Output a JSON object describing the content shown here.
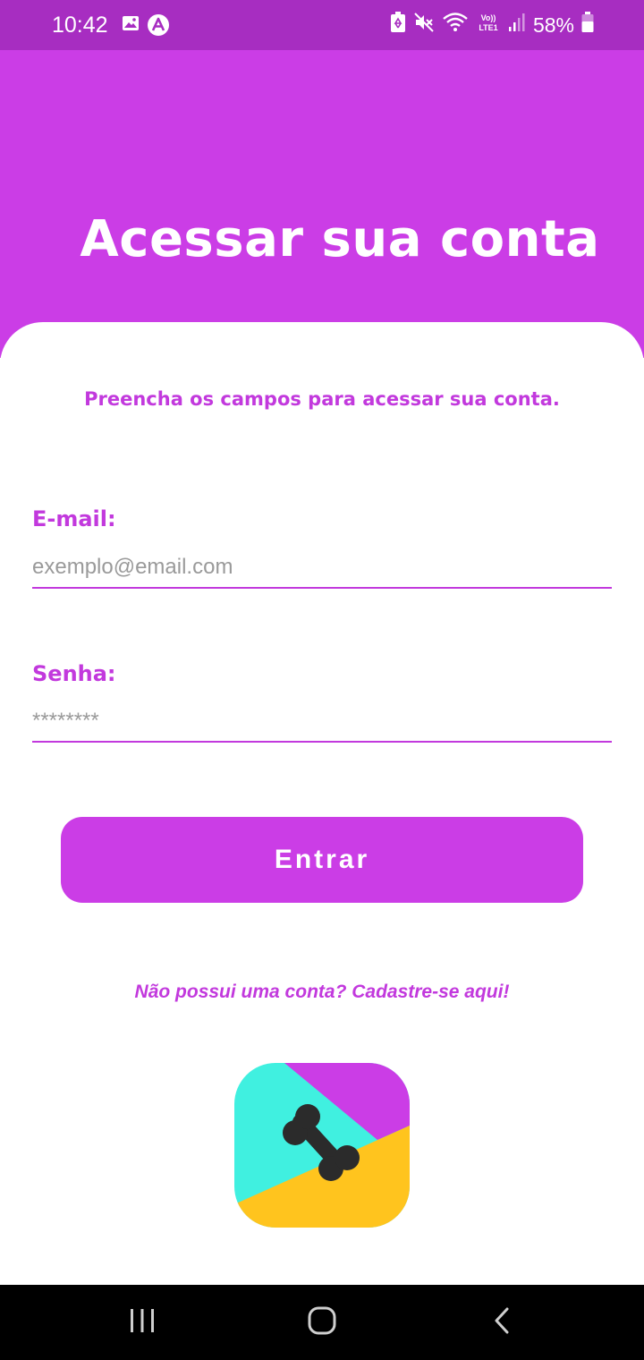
{
  "status_bar": {
    "time": "10:42",
    "battery_percent": "58%",
    "icons": [
      "image-icon",
      "notification-app-icon",
      "battery-saver-icon",
      "mute-icon",
      "wifi-icon",
      "volte-icon",
      "signal-icon",
      "battery-icon"
    ]
  },
  "header": {
    "title": "Acessar sua conta"
  },
  "form": {
    "subtitle": "Preencha os campos para acessar sua conta.",
    "email": {
      "label": "E-mail:",
      "placeholder": "exemplo@email.com",
      "value": ""
    },
    "password": {
      "label": "Senha:",
      "placeholder": "********",
      "value": ""
    },
    "submit_label": "Entrar",
    "signup_link": "Não possui uma conta? Cadastre-se aqui!"
  },
  "logo": {
    "icon": "bone-icon",
    "colors": {
      "cyan": "#40f0e0",
      "purple": "#cb3de6",
      "yellow": "#ffc41e",
      "bone": "#2b2b2b"
    }
  },
  "nav_bar": {
    "buttons": [
      "recent-apps-icon",
      "home-icon",
      "back-icon"
    ]
  },
  "colors": {
    "status_bar": "#a72dc1",
    "header": "#cb3de6",
    "accent_text": "#c239dd",
    "button": "#cb3de6",
    "placeholder": "#9a9a9a"
  }
}
